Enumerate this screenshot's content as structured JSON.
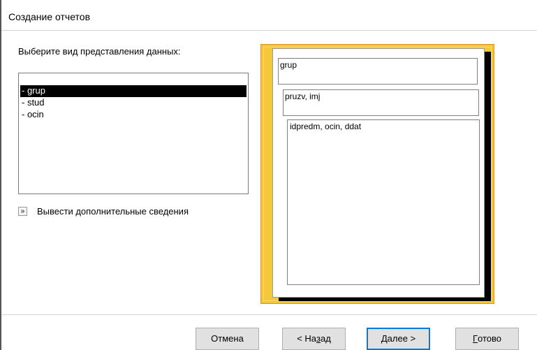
{
  "window": {
    "title": "Создание отчетов"
  },
  "prompt": "Выберите вид представления данных:",
  "list": {
    "items": [
      {
        "label": "- grup",
        "selected": true
      },
      {
        "label": "- stud",
        "selected": false
      },
      {
        "label": "- ocin",
        "selected": false
      }
    ]
  },
  "more_info": {
    "icon": "»",
    "label": "Вывести дополнительные сведения"
  },
  "preview": {
    "level1": "grup",
    "level2": "pruzv, imj",
    "level3": "idpredm, ocin, ddat"
  },
  "buttons": {
    "cancel": "Отмена",
    "back_pre": "< На",
    "back_mnemonic": "з",
    "back_post": "ад",
    "next_mnemonic": "Д",
    "next_post": "алее >",
    "finish_mnemonic": "Г",
    "finish_post": "отово"
  },
  "colors": {
    "preview_bg": "#f5c73b",
    "default_button_border": "#0078d7",
    "selection": "#000000"
  }
}
